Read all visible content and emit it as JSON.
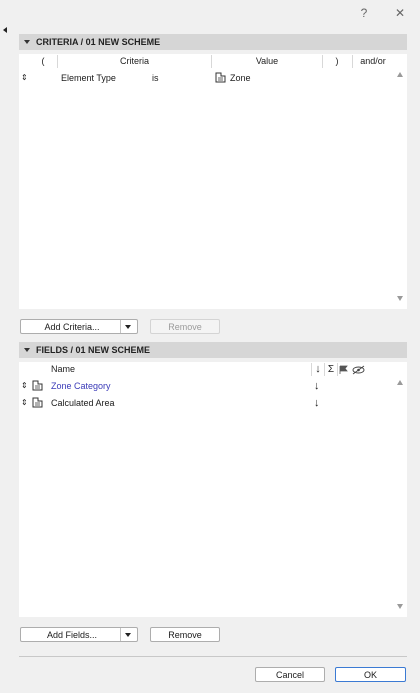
{
  "window": {
    "help_label": "?",
    "close_label": "✕"
  },
  "criteria": {
    "header": "CRITERIA / 01 NEW SCHEME",
    "columns": {
      "open_paren": "(",
      "criteria": "Criteria",
      "value": "Value",
      "close_paren": ")",
      "andor": "and/or"
    },
    "rows": [
      {
        "drag": "⇕",
        "criteria": "Element Type",
        "operator": "is",
        "value": "Zone",
        "value_icon": "zone-icon"
      }
    ],
    "add_button": "Add Criteria...",
    "remove_button": "Remove"
  },
  "fields": {
    "header": "FIELDS / 01 NEW SCHEME",
    "columns": {
      "name": "Name",
      "sort": "↓",
      "sum": "Σ",
      "flag": "flag-icon",
      "hide": "hide-icon"
    },
    "rows": [
      {
        "drag": "⇕",
        "name": "Zone Category",
        "sort": "↓",
        "icon": "zone-icon",
        "highlight": true
      },
      {
        "drag": "⇕",
        "name": "Calculated Area",
        "sort": "↓",
        "icon": "zone-icon",
        "highlight": false
      }
    ],
    "add_button": "Add Fields...",
    "remove_button": "Remove"
  },
  "footer": {
    "cancel": "Cancel",
    "ok": "OK"
  },
  "colors": {
    "header_bg": "#d6d6d6",
    "link_blue": "#3a3ab8",
    "ok_border": "#3b7ad3"
  }
}
